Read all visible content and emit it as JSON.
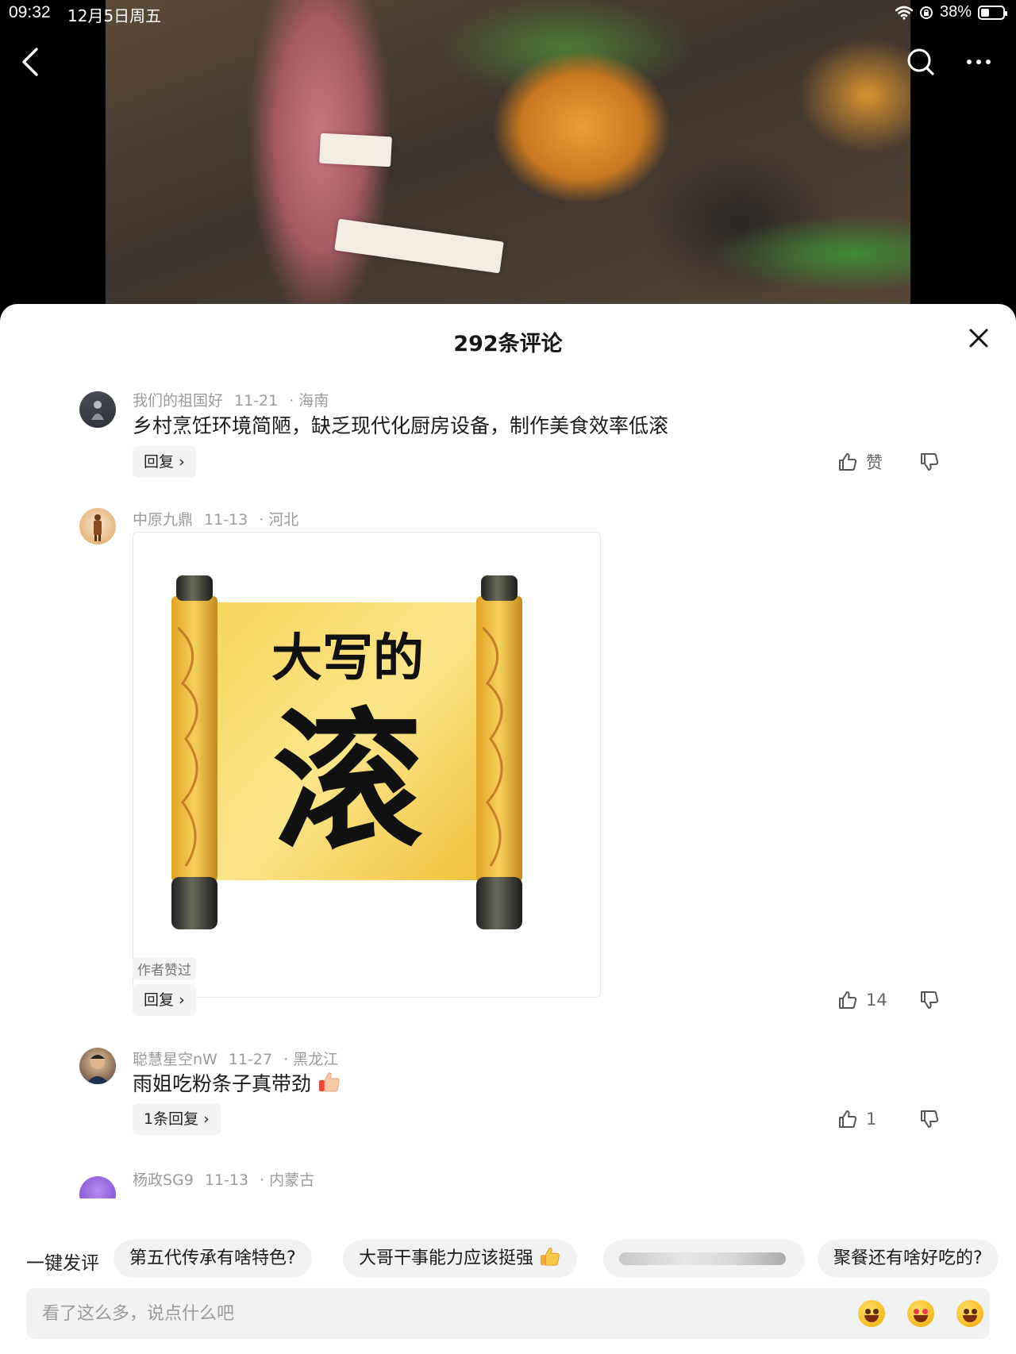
{
  "status_bar": {
    "time": "09:32",
    "date": "12月5日周五",
    "battery": "38%",
    "battery_level": 0.38
  },
  "sheet": {
    "title": "292条评论"
  },
  "comments": [
    {
      "user": "我们的祖国好",
      "date": "11-21",
      "region": "海南",
      "text": "乡村烹饪环境简陋，缺乏现代化厨房设备，制作美食效率低滚",
      "reply_label": "回复",
      "like_label": "赞"
    },
    {
      "user": "中原九鼎",
      "date": "11-13",
      "region": "河北",
      "sticker_line1": "大写的",
      "sticker_line2": "滚",
      "author_badge": "作者赞过",
      "reply_label": "回复",
      "like_label": "14"
    },
    {
      "user": "聪慧星空nW",
      "date": "11-27",
      "region": "黑龙江",
      "text": "雨姐吃粉条子真带劲",
      "reply_label": "1条回复",
      "like_label": "1"
    },
    {
      "user": "杨政SG9",
      "date": "11-13",
      "region": "内蒙古"
    }
  ],
  "quick_comments": {
    "label": "一键发评",
    "chips": [
      "第五代传承有啥特色?",
      "大哥干事能力应该挺强",
      "",
      "聚餐还有啥好吃的?"
    ]
  },
  "input": {
    "placeholder": "看了这么多，说点什么吧"
  },
  "colors": {
    "sheet_bg": "#ffffff",
    "meta_text": "#9a9a9a",
    "chip_bg": "#f2f2f2",
    "scroll_yellow": "#f6c64a"
  }
}
